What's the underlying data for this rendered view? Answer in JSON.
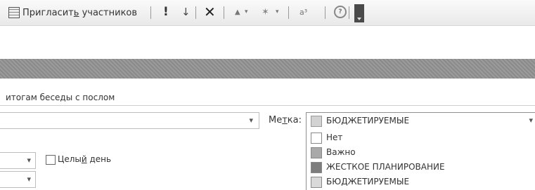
{
  "toolbar": {
    "invite_prefix": "Пригласит",
    "invite_accel": "ь",
    "invite_suffix": " участников",
    "importance_high_glyph": "!",
    "importance_low_glyph": "↓",
    "delete_glyph": "✕",
    "up_glyph": "▲",
    "dropdown_glyph": "▾",
    "flag_glyph": "✶",
    "spell_glyph": "a³",
    "help_glyph": "?"
  },
  "subject": {
    "value": "итогам беседы с послом"
  },
  "location": {
    "value": ""
  },
  "label_field": {
    "caption_prefix": "Ме",
    "caption_accel": "т",
    "caption_suffix": "ка:",
    "selected": "БЮДЖЕТИРУЕМЫЕ",
    "selected_color": "#d2d2d2",
    "options": [
      {
        "name": "Нет",
        "color": "#ffffff"
      },
      {
        "name": "Важно",
        "color": "#a9a9a9"
      },
      {
        "name": "ЖЕСТКОЕ ПЛАНИРОВАНИЕ",
        "color": "#7d7d7d"
      },
      {
        "name": "БЮДЖЕТИРУЕМЫЕ",
        "color": "#d9d9d9"
      }
    ]
  },
  "all_day": {
    "label_prefix": "Целы",
    "label_accel": "й",
    "label_suffix": " день",
    "checked": false
  },
  "chevron_glyph": "▾"
}
